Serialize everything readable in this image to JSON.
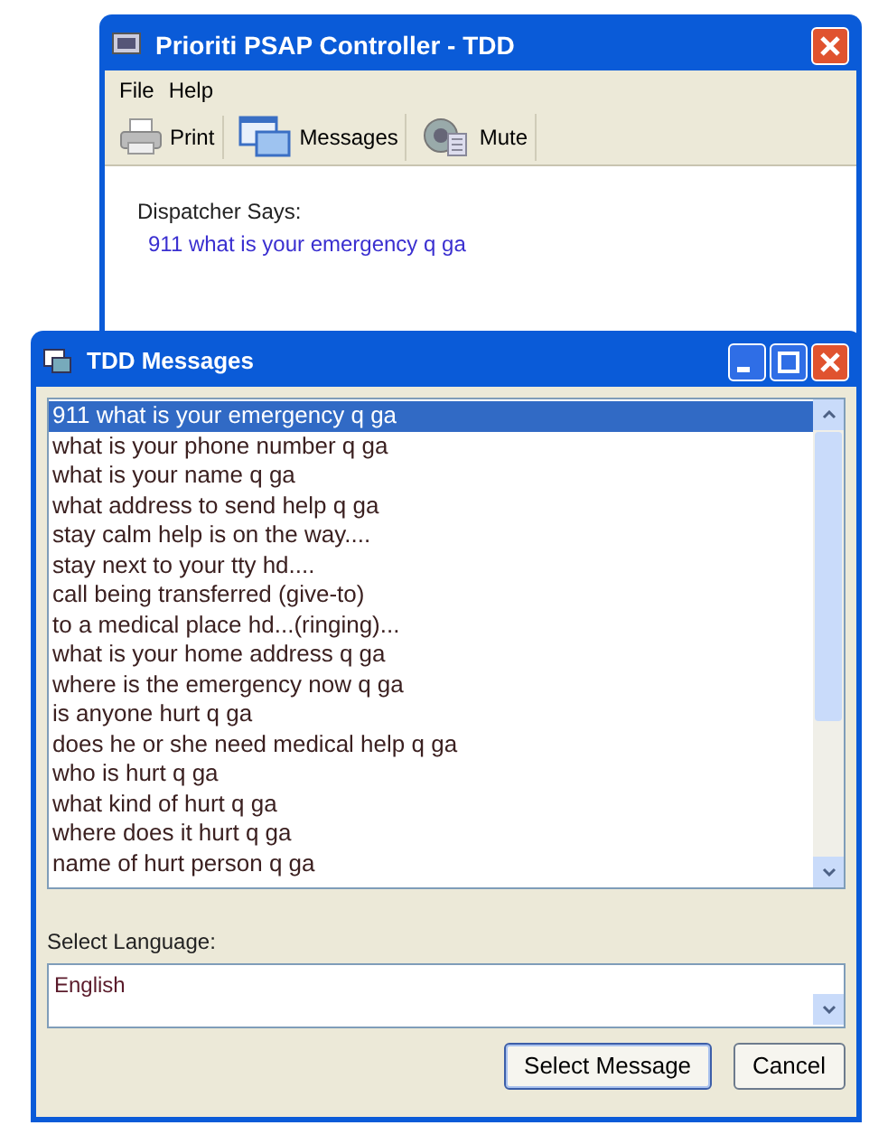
{
  "main_window": {
    "title": "Prioriti PSAP Controller - TDD",
    "menu": [
      {
        "label": "File"
      },
      {
        "label": "Help"
      }
    ],
    "toolbar": [
      {
        "label": "Print",
        "kind": "printer"
      },
      {
        "label": "Messages",
        "kind": "messages"
      },
      {
        "label": "Mute",
        "kind": "speaker"
      }
    ],
    "dispatcher_label": "Dispatcher Says:",
    "dispatcher_message": "911 what is your emergency q ga"
  },
  "dialog": {
    "title": "TDD Messages",
    "messages": [
      {
        "text": "911 what is your emergency q ga",
        "selected": true
      },
      {
        "text": "what is your phone number q ga",
        "selected": false
      },
      {
        "text": "what is your name q ga",
        "selected": false
      },
      {
        "text": "what address to send help q ga",
        "selected": false
      },
      {
        "text": "stay calm help is on the way....",
        "selected": false
      },
      {
        "text": "stay next to your tty hd....",
        "selected": false
      },
      {
        "text": "call being transferred (give-to)",
        "selected": false
      },
      {
        "text": "to a medical place hd...(ringing)...",
        "selected": false
      },
      {
        "text": "what is your home address q ga",
        "selected": false
      },
      {
        "text": "where is the emergency now q ga",
        "selected": false
      },
      {
        "text": "is anyone hurt q ga",
        "selected": false
      },
      {
        "text": "does he or she need medical help q ga",
        "selected": false
      },
      {
        "text": "who is hurt q ga",
        "selected": false
      },
      {
        "text": "what kind of hurt q ga",
        "selected": false
      },
      {
        "text": "where does it hurt q ga",
        "selected": false
      },
      {
        "text": "name of hurt person q ga",
        "selected": false
      }
    ],
    "language_label": "Select Language:",
    "language_value": "English",
    "buttons": [
      "Select Message",
      "Cancel"
    ]
  }
}
